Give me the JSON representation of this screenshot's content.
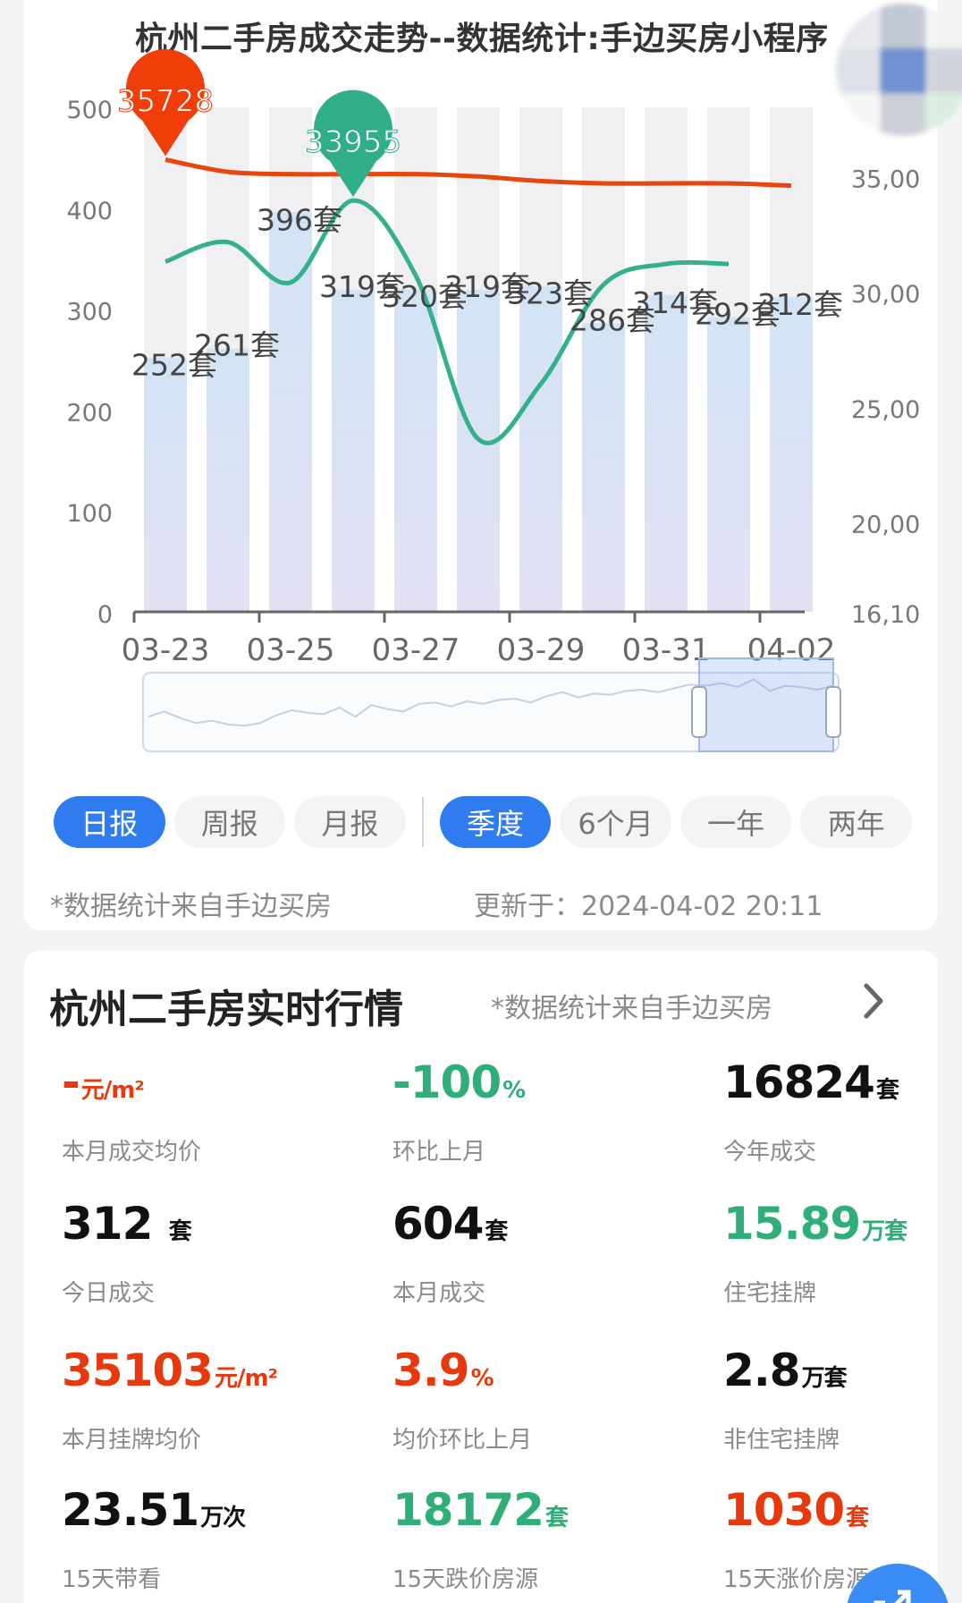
{
  "chart": {
    "title": "杭州二手房成交走势--数据统计:手边买房小程序",
    "left_axis_ticks": [
      "500",
      "400",
      "300",
      "200",
      "100",
      "0"
    ],
    "right_axis_ticks": [
      "35,00",
      "30,00",
      "25,00",
      "20,00",
      "16,10"
    ],
    "x_tick_labels": [
      "03-23",
      "03-25",
      "03-27",
      "03-29",
      "03-31",
      "04-02"
    ]
  },
  "chart_data": {
    "type": "bar",
    "categories": [
      "03-23",
      "03-24",
      "03-25",
      "03-26",
      "03-27",
      "03-28",
      "03-29",
      "03-30",
      "03-31",
      "04-01",
      "04-02"
    ],
    "series": [
      {
        "values": [
          252,
          261,
          396,
          319,
          320,
          319,
          323,
          286,
          314,
          292,
          312
        ],
        "labels": [
          "252套",
          "261套",
          "396套",
          "319套",
          "320套",
          "319套",
          "323套",
          "286套",
          "314套",
          "292套",
          "312套"
        ]
      },
      {
        "type": "line",
        "values": [
          31300,
          32150,
          30400,
          33955,
          30700,
          23600,
          26000,
          30300,
          31200,
          31200
        ]
      },
      {
        "type": "line",
        "values": [
          35728,
          35200,
          35100,
          35100,
          35100,
          35000,
          34800,
          34700,
          34700,
          34700,
          34600
        ]
      }
    ],
    "markers": [
      {
        "value": "35728",
        "color": "#ef3e0a"
      },
      {
        "value": "33955",
        "color": "#2fae89"
      }
    ],
    "ylim": [
      0,
      500
    ],
    "ylim_right": [
      16100,
      38000
    ],
    "colors": {
      "bar": "#d3e3f4",
      "bar_bg": "#f0f0f2",
      "line_price": "#e6470f",
      "line_listing": "#35b08c"
    }
  },
  "range_tabs": [
    {
      "label": "日报",
      "active": true
    },
    {
      "label": "周报",
      "active": false
    },
    {
      "label": "月报",
      "active": false
    }
  ],
  "period_tabs": [
    {
      "label": "季度",
      "active": true
    },
    {
      "label": "6个月",
      "active": false
    },
    {
      "label": "一年",
      "active": false
    },
    {
      "label": "两年",
      "active": false
    }
  ],
  "footnote": {
    "source": "*数据统计来自手边买房",
    "updated": "更新于：2024-04-02 20:11"
  },
  "stats": {
    "title": "杭州二手房实时行情",
    "source": "*数据统计来自手边买房",
    "items": [
      {
        "value": "-",
        "unit": "元/m²",
        "label": "本月成交均价",
        "color": "#e63a0e"
      },
      {
        "value": "-100",
        "unit": "%",
        "label": "环比上月",
        "color": "#2fae77"
      },
      {
        "value": "16824",
        "unit": "套",
        "label": "今年成交",
        "color": "#111111"
      },
      {
        "value": "312 ",
        "unit": "套",
        "label": "今日成交",
        "color": "#111111"
      },
      {
        "value": "604",
        "unit": "套",
        "label": "本月成交",
        "color": "#111111"
      },
      {
        "value": "15.89",
        "unit": "万套",
        "label": "住宅挂牌",
        "color": "#2fae77"
      },
      {
        "value": "35103",
        "unit": "元/m²",
        "label": "本月挂牌均价",
        "color": "#e63a0e"
      },
      {
        "value": "3.9",
        "unit": "%",
        "label": "均价环比上月",
        "color": "#e63a0e"
      },
      {
        "value": "2.8",
        "unit": "万套",
        "label": "非住宅挂牌",
        "color": "#111111"
      },
      {
        "value": "23.51",
        "unit": "万次",
        "label": "15天带看",
        "color": "#111111"
      },
      {
        "value": "18172",
        "unit": "套",
        "label": "15天跌价房源",
        "color": "#2fae77"
      },
      {
        "value": "1030",
        "unit": "套",
        "label": "15天涨价房源",
        "color": "#e63a0e"
      }
    ]
  }
}
